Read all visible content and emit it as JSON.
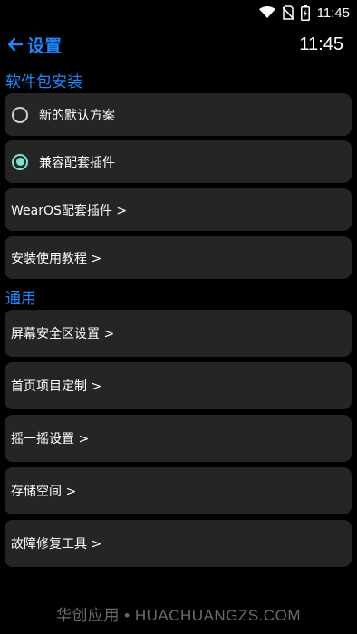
{
  "status_bar": {
    "time": "11:45",
    "icons": [
      "wifi-icon",
      "no-sim-icon",
      "battery-charging-icon"
    ]
  },
  "app_bar": {
    "back_icon": "arrow-left-icon",
    "title": "设置",
    "clock": "11:45"
  },
  "sections": {
    "package": {
      "title": "软件包安装",
      "options": [
        {
          "label": "新的默认方案",
          "selected": false
        },
        {
          "label": "兼容配套插件",
          "selected": true
        }
      ],
      "links": [
        {
          "label": "WearOS配套插件 >"
        },
        {
          "label": "安装使用教程 >"
        }
      ]
    },
    "general": {
      "title": "通用",
      "links": [
        {
          "label": "屏幕安全区设置 >"
        },
        {
          "label": "首页项目定制 >"
        },
        {
          "label": "摇一摇设置 >"
        },
        {
          "label": "存储空间 >"
        },
        {
          "label": "故障修复工具 >"
        }
      ]
    }
  },
  "watermark": "华创应用 • HUACHUANGZS.COM",
  "colors": {
    "accent": "#1e88ff",
    "radio_checked": "#7fe0cf",
    "card_bg": "#252525",
    "background": "#000000"
  }
}
